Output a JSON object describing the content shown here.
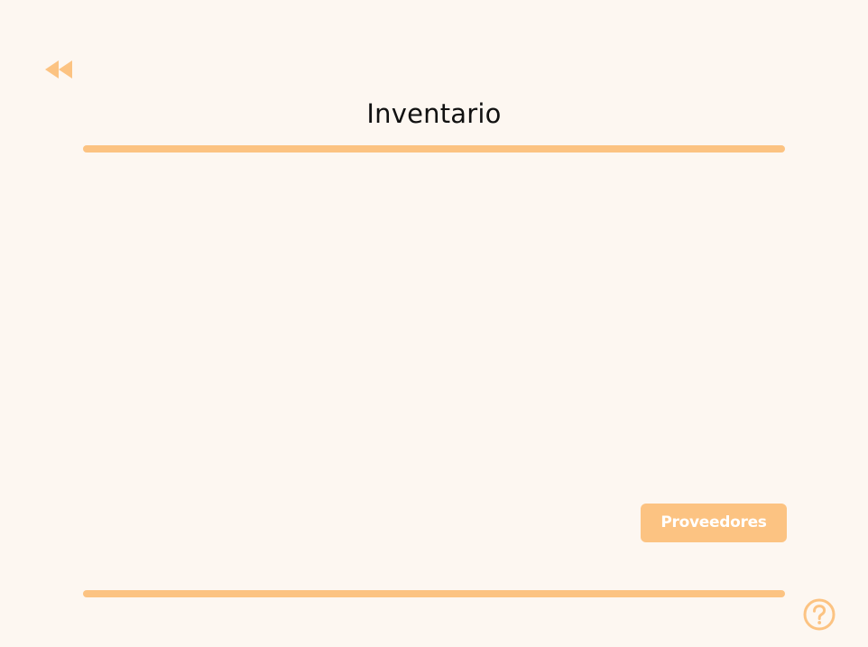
{
  "header": {
    "title": "Inventario",
    "back_icon": "double-chevron-left-icon"
  },
  "actions": {
    "suppliers_label": "Proveedores"
  },
  "footer": {
    "help_icon": "question-circle-icon"
  },
  "colors": {
    "background": "#fdf7f1",
    "accent": "#fcc382",
    "title_text": "#111111",
    "button_text": "#ffffff"
  }
}
